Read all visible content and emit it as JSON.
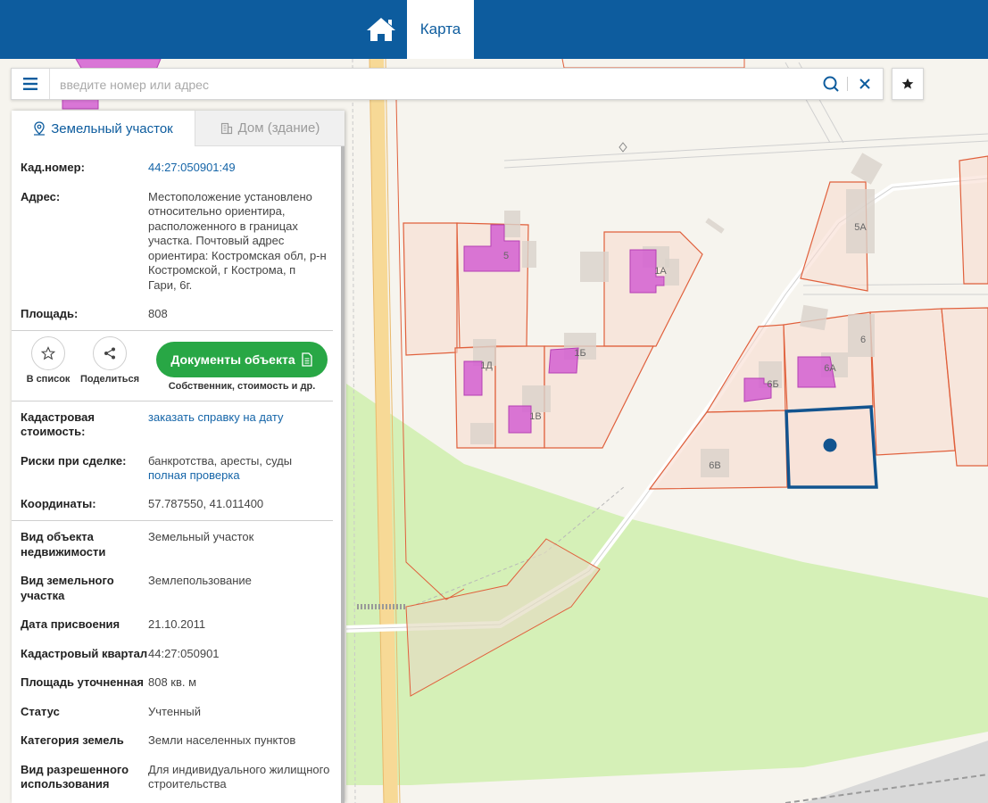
{
  "header": {
    "map_tab": "Карта"
  },
  "search": {
    "placeholder": "введите номер или адрес"
  },
  "panel": {
    "tabs": {
      "land": "Земельный участок",
      "building": "Дом (здание)"
    },
    "kad_nomer": {
      "label": "Кад.номер:",
      "value": "44:27:050901:49"
    },
    "address": {
      "label": "Адрес:",
      "value": "Местоположение установлено относительно ориентира, расположенного в границах участка. Почтовый адрес ориентира: Костромская обл, р-н Костромской, г Кострома, п Гари, 6г."
    },
    "area": {
      "label": "Площадь:",
      "value": "808"
    },
    "actions": {
      "to_list": "В список",
      "share": "Поделиться",
      "documents": "Документы объекта",
      "documents_sub": "Собственник, стоимость и др."
    },
    "cad_value": {
      "label": "Кадастровая стоимость:",
      "link": "заказать справку на дату"
    },
    "risks": {
      "label": "Риски при сделке:",
      "value": "банкротства, аресты, суды",
      "link": "полная проверка"
    },
    "coords": {
      "label": "Координаты:",
      "value": "57.787550, 41.011400"
    },
    "details": [
      {
        "label": "Вид объекта недвижимости",
        "value": "Земельный участок"
      },
      {
        "label": "Вид земельного участка",
        "value": "Землепользование"
      },
      {
        "label": "Дата присвоения",
        "value": "21.10.2011"
      },
      {
        "label": "Кадастровый квартал",
        "value": "44:27:050901"
      },
      {
        "label": "Площадь уточненная",
        "value": "808 кв. м"
      },
      {
        "label": "Статус",
        "value": "Учтенный"
      },
      {
        "label": "Категория земель",
        "value": "Земли населенных пунктов"
      },
      {
        "label": "Вид разрешенного использования",
        "value": "Для индивидуального жилищного строительства"
      }
    ]
  },
  "map": {
    "parcel_labels": [
      "5",
      "1А",
      "1Д",
      "1Б",
      "1В",
      "5А",
      "6",
      "6А",
      "6Б",
      "6В"
    ]
  },
  "colors": {
    "header": "#0d5c9e",
    "parcel_stroke": "#e0603c",
    "parcel_fill": "#f9dcd0",
    "building": "#d35fd1",
    "selected": "#12548f",
    "green_area": "#d5f0b7",
    "docs_button": "#28a745"
  }
}
